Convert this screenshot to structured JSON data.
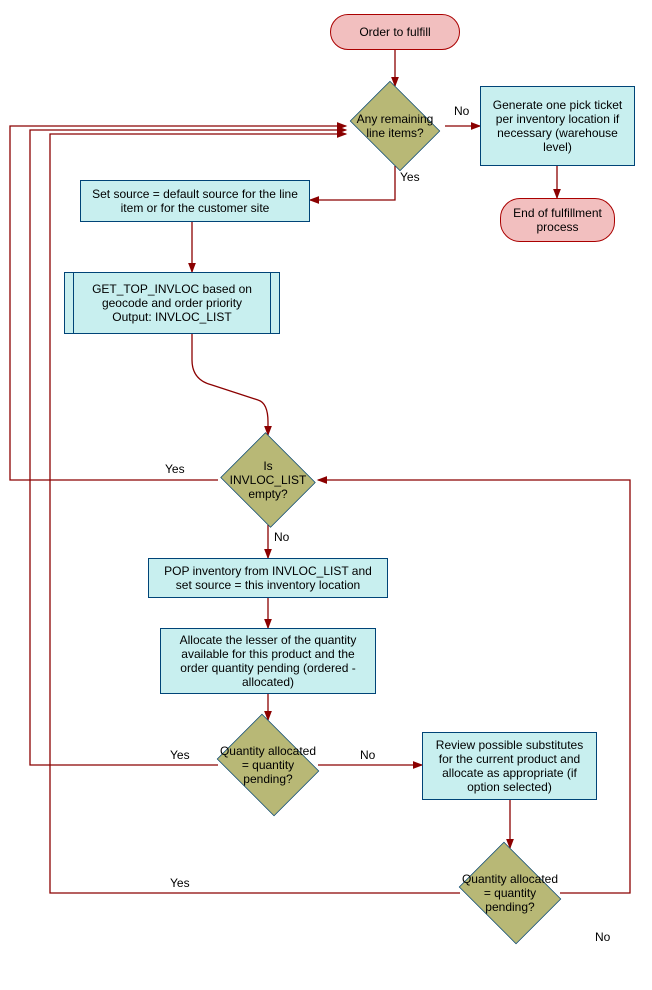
{
  "chart_data": {
    "type": "flowchart",
    "nodes": {
      "start": {
        "type": "terminator",
        "text": "Order to fulfill"
      },
      "d1": {
        "type": "decision",
        "text": "Any remaining line items?"
      },
      "p_ticket": {
        "type": "process",
        "text": "Generate one pick ticket per inventory location if necessary  (warehouse level)"
      },
      "end": {
        "type": "terminator",
        "text": "End of fulfillment process"
      },
      "p_source": {
        "type": "process",
        "text": "Set source = default source for the line item or for the customer site"
      },
      "p_gettop": {
        "type": "subprocess",
        "text": "GET_TOP_INVLOC based on geocode and order priority Output: INVLOC_LIST"
      },
      "d2": {
        "type": "decision",
        "text": "Is INVLOC_LIST empty?"
      },
      "p_pop": {
        "type": "process",
        "text": "POP inventory from  INVLOC_LIST and set source = this inventory location"
      },
      "p_alloc": {
        "type": "process",
        "text": "Allocate the lesser of the quantity available for this product and the order quantity pending (ordered - allocated)"
      },
      "d3": {
        "type": "decision",
        "text": "Quantity allocated = quantity pending?"
      },
      "p_subst": {
        "type": "process",
        "text": "Review possible substitutes for the current product and allocate as appropriate (if option selected)"
      },
      "d4": {
        "type": "decision",
        "text": "Quantity allocated = quantity pending?"
      }
    },
    "edges": [
      {
        "from": "start",
        "to": "d1"
      },
      {
        "from": "d1",
        "to": "p_ticket",
        "label": "No"
      },
      {
        "from": "d1",
        "to": "p_source",
        "label": "Yes"
      },
      {
        "from": "p_ticket",
        "to": "end"
      },
      {
        "from": "p_source",
        "to": "p_gettop"
      },
      {
        "from": "p_gettop",
        "to": "d2"
      },
      {
        "from": "d2",
        "to": "d1",
        "label": "Yes"
      },
      {
        "from": "d2",
        "to": "p_pop",
        "label": "No"
      },
      {
        "from": "p_pop",
        "to": "p_alloc"
      },
      {
        "from": "p_alloc",
        "to": "d3"
      },
      {
        "from": "d3",
        "to": "d1",
        "label": "Yes"
      },
      {
        "from": "d3",
        "to": "p_subst",
        "label": "No"
      },
      {
        "from": "p_subst",
        "to": "d4"
      },
      {
        "from": "d4",
        "to": "d1",
        "label": "Yes"
      },
      {
        "from": "d4",
        "to": "d2",
        "label": "No"
      }
    ],
    "labels": {
      "yes": "Yes",
      "no": "No"
    }
  }
}
